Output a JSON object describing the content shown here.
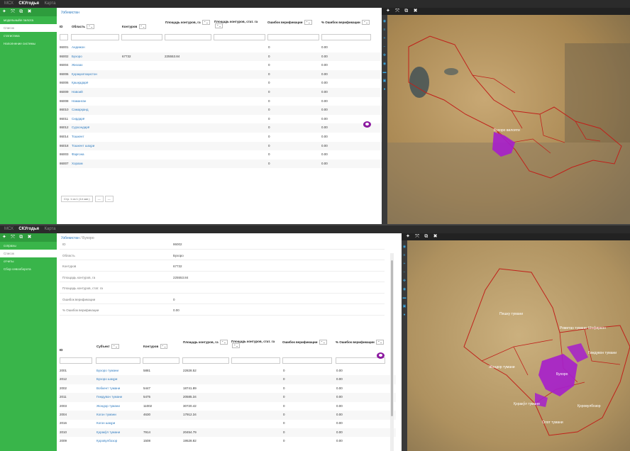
{
  "app": {
    "menu": [
      {
        "label": "МСХ",
        "active": false
      },
      {
        "label": "СКУгодья",
        "active": true
      },
      {
        "label": "Карта",
        "active": false
      }
    ],
    "sidebar_tool_icons": [
      "plus-icon",
      "expand-icon",
      "popout-icon",
      "close-icon"
    ]
  },
  "top": {
    "sidebar_items": [
      {
        "label": "модельныйе пилота",
        "selected": false
      },
      {
        "label": "Список",
        "selected": true
      },
      {
        "label": "статистика",
        "selected": false
      },
      {
        "label": "Наполнение системы",
        "selected": false
      }
    ],
    "breadcrumb": "Узбекистан",
    "columns": [
      "ID",
      "Область",
      "Контуров",
      "Площадь контуров, га",
      "Площадь контуров, стат. га",
      "Ошибок верификации",
      "% Ошибок верификации"
    ],
    "rows": [
      {
        "id": "86001",
        "name": "Андижон",
        "contours": "",
        "area": "",
        "stat_area": "",
        "errors": "0",
        "pct": "0.00"
      },
      {
        "id": "86002",
        "name": "Бухоро",
        "contours": "67732",
        "area": "225553.84",
        "stat_area": "",
        "errors": "0",
        "pct": "0.00"
      },
      {
        "id": "86004",
        "name": "Жиззах",
        "contours": "",
        "area": "",
        "stat_area": "",
        "errors": "0",
        "pct": "0.00"
      },
      {
        "id": "86006",
        "name": "Қорақалпоқистон",
        "contours": "",
        "area": "",
        "stat_area": "",
        "errors": "0",
        "pct": "0.00"
      },
      {
        "id": "86006",
        "name": "Қашқадарё",
        "contours": "",
        "area": "",
        "stat_area": "",
        "errors": "0",
        "pct": "0.00"
      },
      {
        "id": "86009",
        "name": "Навоий",
        "contours": "",
        "area": "",
        "stat_area": "",
        "errors": "0",
        "pct": "0.00"
      },
      {
        "id": "86008",
        "name": "Наманган",
        "contours": "",
        "area": "",
        "stat_area": "",
        "errors": "0",
        "pct": "0.00"
      },
      {
        "id": "86010",
        "name": "Самарқанд",
        "contours": "",
        "area": "",
        "stat_area": "",
        "errors": "0",
        "pct": "0.00"
      },
      {
        "id": "86011",
        "name": "Сирдарё",
        "contours": "",
        "area": "",
        "stat_area": "",
        "errors": "0",
        "pct": "0.00"
      },
      {
        "id": "86012",
        "name": "Сурхондарё",
        "contours": "",
        "area": "",
        "stat_area": "",
        "errors": "0",
        "pct": "0.00"
      },
      {
        "id": "86014",
        "name": "Тошкент",
        "contours": "",
        "area": "",
        "stat_area": "",
        "errors": "0",
        "pct": "0.00"
      },
      {
        "id": "86018",
        "name": "Тошкент шаҳри",
        "contours": "",
        "area": "",
        "stat_area": "",
        "errors": "0",
        "pct": "0.00"
      },
      {
        "id": "86003",
        "name": "Фарғона",
        "contours": "",
        "area": "",
        "stat_area": "",
        "errors": "0",
        "pct": "0.00"
      },
      {
        "id": "86007",
        "name": "Хоразм",
        "contours": "",
        "area": "",
        "stat_area": "",
        "errors": "0",
        "pct": "0.00"
      }
    ],
    "pager": {
      "range": "Стр. 1 из 1 (14 зап.)"
    },
    "map_labels": [
      "Бухоро вилояти"
    ]
  },
  "bottom": {
    "sidebar_items": [
      {
        "label": "сопрахы",
        "selected": false
      },
      {
        "label": "Список",
        "selected": true
      },
      {
        "label": "отчеты",
        "selected": false
      },
      {
        "label": "Сбор севооборота",
        "selected": false
      }
    ],
    "breadcrumb": {
      "root": "Узбекистан",
      "sep": "/",
      "current": "Бухоро"
    },
    "details": [
      {
        "key": "ID",
        "value": "86002"
      },
      {
        "key": "Область",
        "value": "Бухоро"
      },
      {
        "key": "Контуров",
        "value": "67732"
      },
      {
        "key": "Площадь контуров, га",
        "value": "225553.84"
      },
      {
        "key": "Площадь контуров, стат. га",
        "value": ""
      },
      {
        "key": "Ошибок верификации",
        "value": "0"
      },
      {
        "key": "% Ошибок верификации",
        "value": "0.00"
      }
    ],
    "columns": [
      "ID",
      "Субъект",
      "Контуров",
      "Площадь контуров, га",
      "Площадь контуров, стат. га",
      "Ошибок верификации",
      "% Ошибок верификации"
    ],
    "rows": [
      {
        "id": "2001",
        "name": "Бухоро тумани",
        "contours": "5881",
        "area": "22828.52",
        "errors": "0",
        "pct": "0.00"
      },
      {
        "id": "2012",
        "name": "Бухоро шаҳри",
        "contours": "",
        "area": "",
        "errors": "0",
        "pct": "0.00"
      },
      {
        "id": "2002",
        "name": "Вобкент тумани",
        "contours": "5447",
        "area": "18741.89",
        "errors": "0",
        "pct": "0.00"
      },
      {
        "id": "2011",
        "name": "Гиждувон тумани",
        "contours": "5475",
        "area": "20585.34",
        "errors": "0",
        "pct": "0.00"
      },
      {
        "id": "2003",
        "name": "Жондор тумани",
        "contours": "11002",
        "area": "30720.42",
        "errors": "0",
        "pct": "0.00"
      },
      {
        "id": "2004",
        "name": "Когон тумани",
        "contours": "4630",
        "area": "17912.34",
        "errors": "0",
        "pct": "0.00"
      },
      {
        "id": "2016",
        "name": "Когон шаҳри",
        "contours": "",
        "area": "",
        "errors": "0",
        "pct": "0.00"
      },
      {
        "id": "2010",
        "name": "Қоракўл тумани",
        "contours": "7914",
        "area": "20454.79",
        "errors": "0",
        "pct": "0.00"
      },
      {
        "id": "2009",
        "name": "Қоровулбозор",
        "contours": "1508",
        "area": "19528.82",
        "errors": "0",
        "pct": "0.00"
      }
    ],
    "map_labels": [
      "Пешку тумани",
      "Ромитан тумани",
      "Шофиркон",
      "Жондор тумани",
      "Бухоро",
      "Қоракўл тумани",
      "Олот тумани",
      "Қоровулбозор",
      "Гиждувон тумани"
    ]
  },
  "map_icons": [
    "location-icon",
    "layers-icon",
    "plus-icon",
    "minus-icon",
    "move-icon",
    "eye-icon",
    "folder-icon",
    "print-icon",
    "globe-icon"
  ],
  "colors": {
    "accent": "#39b54a",
    "link": "#2f7bbf",
    "highlight": "#a61ecc",
    "boundary": "#c0201a"
  }
}
